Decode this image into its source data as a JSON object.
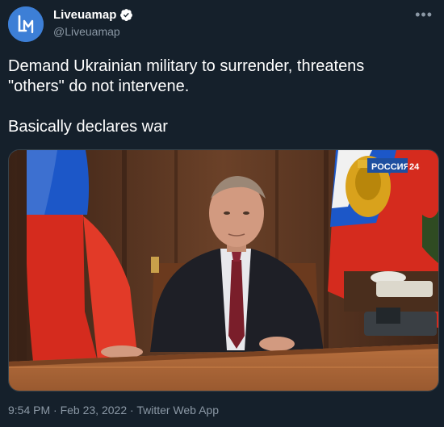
{
  "author": {
    "display_name": "Liveuamap",
    "handle": "@Liveuamap",
    "avatar_letters": "LM",
    "verified": true
  },
  "tweet": {
    "line1": "Demand Ukrainian military to surrender, threatens",
    "line2": "\"others\" do not intervene.",
    "line3": "Basically declares war"
  },
  "media": {
    "broadcaster_text": "РОССИЯ",
    "broadcaster_number": "24"
  },
  "meta": {
    "time": "9:54 PM",
    "date": "Feb 23, 2022",
    "source": "Twitter Web App",
    "separator": "·"
  },
  "icons": {
    "more": "more-options-icon",
    "verified": "verified-badge-icon"
  },
  "colors": {
    "background": "#15202b",
    "secondary_text": "#8b98a5",
    "avatar": "#3d7fd6",
    "verified": "#1d9bf0"
  }
}
